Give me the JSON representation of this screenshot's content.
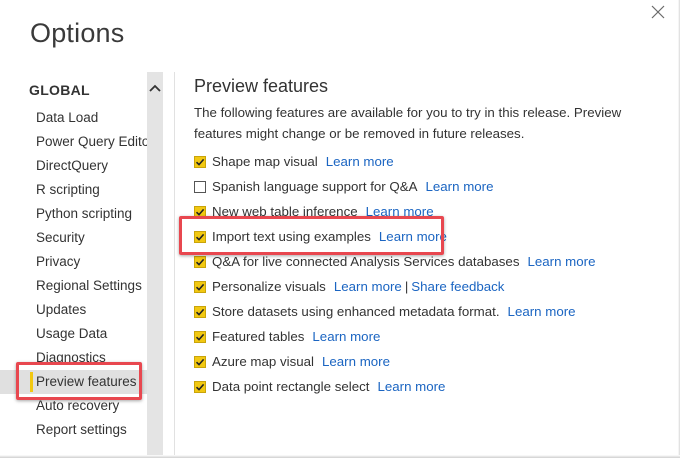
{
  "window": {
    "title": "Options"
  },
  "sidebar": {
    "group_title": "GLOBAL",
    "items": [
      {
        "label": "Data Load",
        "selected": false
      },
      {
        "label": "Power Query Editor",
        "selected": false
      },
      {
        "label": "DirectQuery",
        "selected": false
      },
      {
        "label": "R scripting",
        "selected": false
      },
      {
        "label": "Python scripting",
        "selected": false
      },
      {
        "label": "Security",
        "selected": false
      },
      {
        "label": "Privacy",
        "selected": false
      },
      {
        "label": "Regional Settings",
        "selected": false
      },
      {
        "label": "Updates",
        "selected": false
      },
      {
        "label": "Usage Data",
        "selected": false
      },
      {
        "label": "Diagnostics",
        "selected": false
      },
      {
        "label": "Preview features",
        "selected": true
      },
      {
        "label": "Auto recovery",
        "selected": false
      },
      {
        "label": "Report settings",
        "selected": false
      }
    ]
  },
  "main": {
    "section_title": "Preview features",
    "description": "The following features are available for you to try in this release. Preview features might change or be removed in future releases.",
    "features": [
      {
        "label": "Shape map visual",
        "checked": true,
        "link": "Learn more"
      },
      {
        "label": "Spanish language support for Q&A",
        "checked": false,
        "link": "Learn more"
      },
      {
        "label": "New web table inference",
        "checked": true,
        "link": "Learn more"
      },
      {
        "label": "Import text using examples",
        "checked": true,
        "link": "Learn more"
      },
      {
        "label": "Q&A for live connected Analysis Services databases",
        "checked": true,
        "link": "Learn more"
      },
      {
        "label": "Personalize visuals",
        "checked": true,
        "link": "Learn more",
        "link2": "Share feedback"
      },
      {
        "label": "Store datasets using enhanced metadata format.",
        "checked": true,
        "link": "Learn more"
      },
      {
        "label": "Featured tables",
        "checked": true,
        "link": "Learn more"
      },
      {
        "label": "Azure map visual",
        "checked": true,
        "link": "Learn more"
      },
      {
        "label": "Data point rectangle select",
        "checked": true,
        "link": "Learn more"
      }
    ]
  },
  "colors": {
    "accent": "#f2c811",
    "link": "#1b65c2",
    "highlight": "#e8474f",
    "selected_bg": "#e0e0e0"
  },
  "icons": {
    "close": "close-icon",
    "scroll_up": "chevron-up-icon",
    "check": "checkmark-icon"
  }
}
